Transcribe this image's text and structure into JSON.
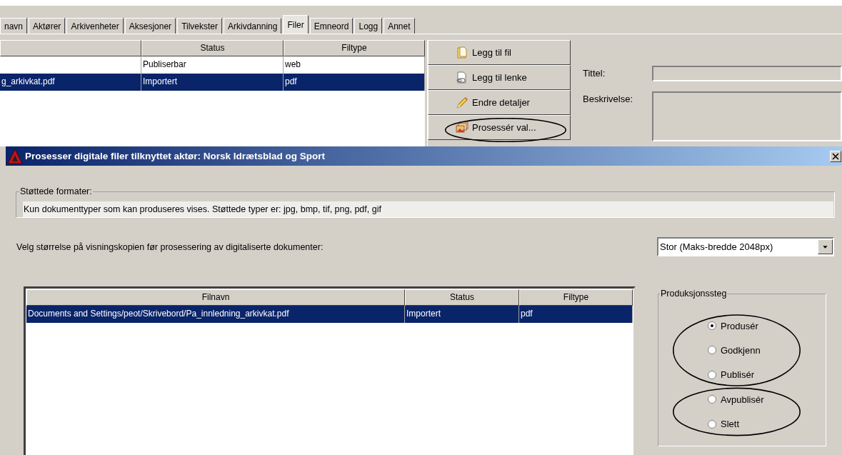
{
  "tabs": [
    {
      "label": "navn",
      "selected": false
    },
    {
      "label": "Aktører",
      "selected": false
    },
    {
      "label": "Arkivenheter",
      "selected": false
    },
    {
      "label": "Aksesjoner",
      "selected": false
    },
    {
      "label": "Tilvekster",
      "selected": false
    },
    {
      "label": "Arkivdanning",
      "selected": false
    },
    {
      "label": "Filer",
      "selected": true
    },
    {
      "label": "Emneord",
      "selected": false
    },
    {
      "label": "Logg",
      "selected": false
    },
    {
      "label": "Annet",
      "selected": false
    }
  ],
  "file_table": {
    "columns": [
      "Status",
      "Filtype"
    ],
    "rows": [
      {
        "status": "Publiserbar",
        "filtype": "web",
        "selected": false
      },
      {
        "column_1": "g_arkivkat.pdf",
        "status": "Importert",
        "filtype": "pdf",
        "selected": true
      }
    ]
  },
  "actions": [
    {
      "label": "Legg til fil",
      "kind": "folder",
      "circled": false
    },
    {
      "label": "Legg til lenke",
      "kind": "link",
      "circled": false
    },
    {
      "label": "Endre detaljer",
      "kind": "pencil",
      "circled": false
    },
    {
      "label": "Prosessér val...",
      "kind": "images",
      "circled": true
    }
  ],
  "details": [
    {
      "label": "Tittel:",
      "kind": "line"
    },
    {
      "label": "Beskrivelse:",
      "kind": "multiline"
    }
  ],
  "dialog": {
    "title": "Prosesser digitale filer tilknyttet aktør: Norsk Idrætsblad og Sport",
    "supported_formats": {
      "legend": "Støttede formater:",
      "text": "Kun dokumenttyper som kan produseres vises. Støttede typer er: jpg, bmp, tif, png, pdf, gif"
    },
    "size": {
      "label": "Velg størrelse på visningskopien før prosessering av digitaliserte dokumenter:",
      "value": "Stor (Maks-bredde 2048px)"
    },
    "table": {
      "columns": [
        "Filnavn",
        "Status",
        "Filtype"
      ],
      "rows": [
        {
          "filnavn": "Documents and Settings/peot/Skrivebord/Pa_innledning_arkivkat.pdf",
          "status": "Importert",
          "filtype": "pdf",
          "selected": true
        }
      ]
    },
    "production": {
      "legend": "Produksjonssteg",
      "groups": [
        {
          "circled": true,
          "options": [
            {
              "label": "Produsér",
              "selected": true
            },
            {
              "label": "Godkjenn",
              "selected": false
            },
            {
              "label": "Publisér",
              "selected": false
            }
          ]
        },
        {
          "circled": true,
          "options": [
            {
              "label": "Avpublisér",
              "selected": false
            },
            {
              "label": "Slett",
              "selected": false
            }
          ]
        }
      ]
    }
  }
}
